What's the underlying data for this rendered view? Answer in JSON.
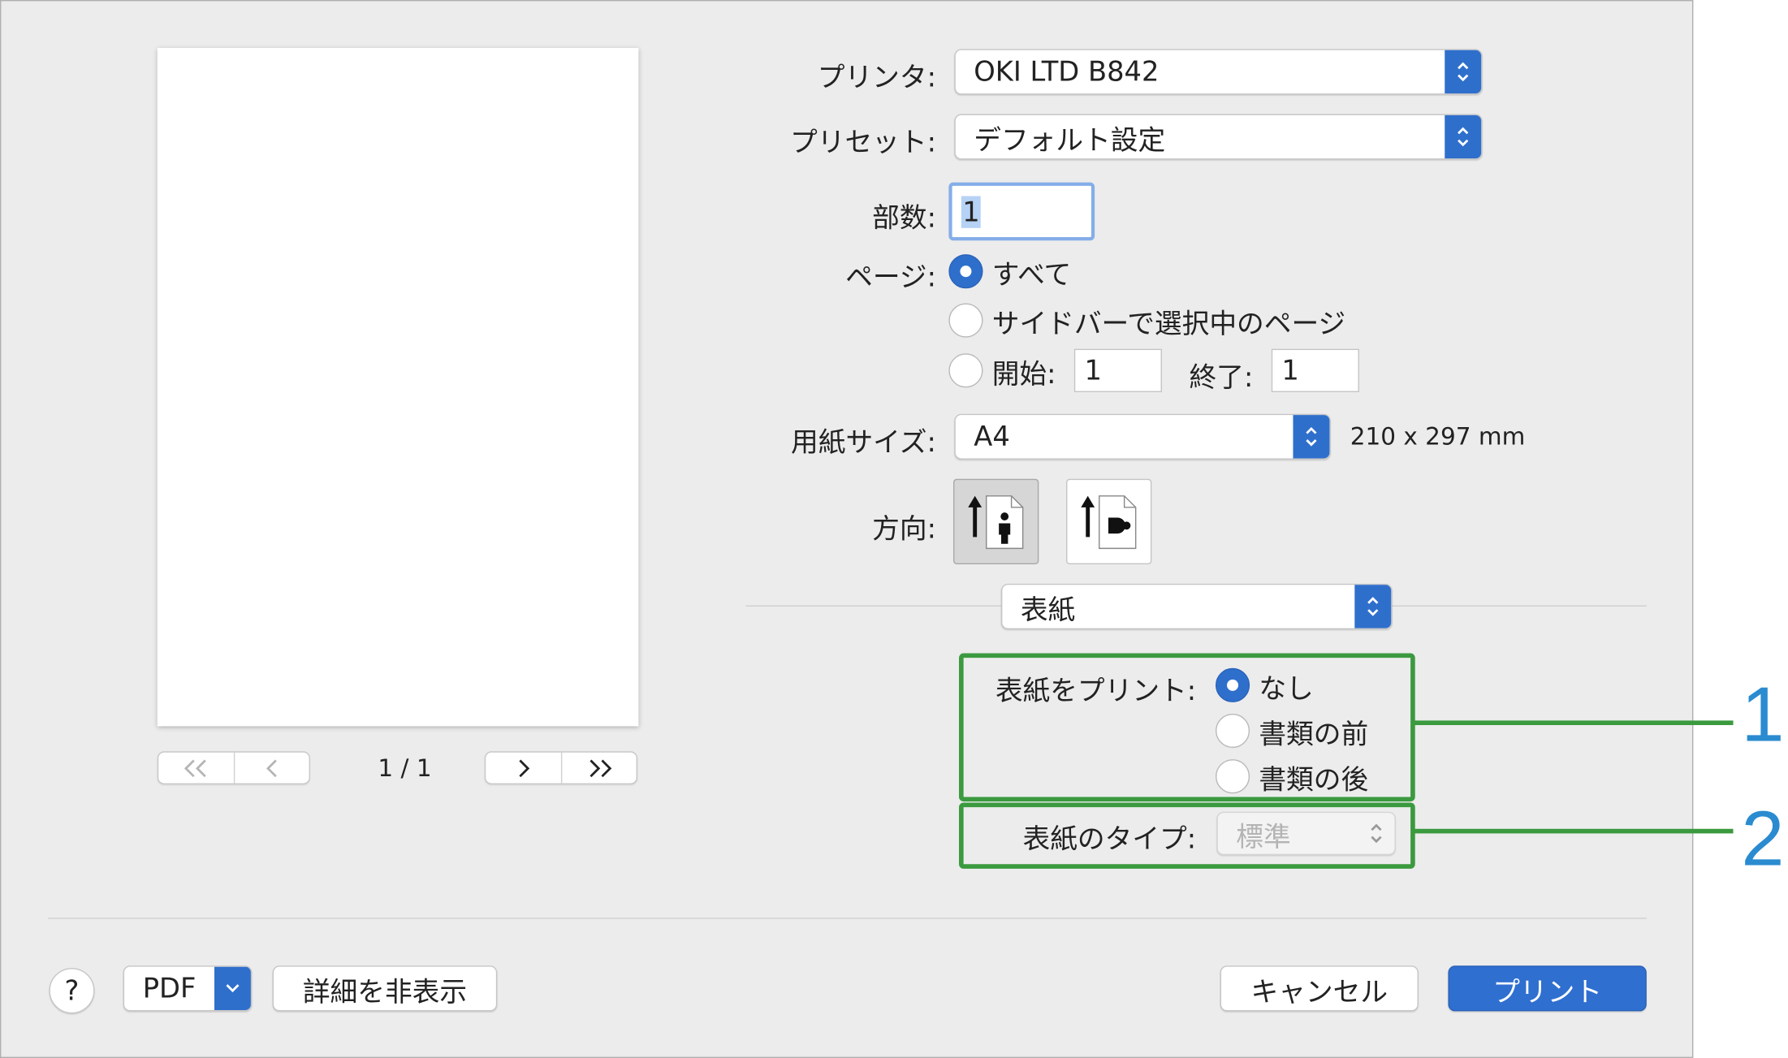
{
  "printer": {
    "label": "プリンタ:",
    "value": "OKI LTD B842"
  },
  "preset": {
    "label": "プリセット:",
    "value": "デフォルト設定"
  },
  "copies": {
    "label": "部数:",
    "value": "1"
  },
  "pages": {
    "label": "ページ:",
    "options": [
      "すべて",
      "サイドバーで選択中のページ"
    ],
    "selected": "すべて",
    "range_from_label": "開始:",
    "range_from_value": "1",
    "range_to_label": "終了:",
    "range_to_value": "1"
  },
  "paper_size": {
    "label": "用紙サイズ:",
    "value": "A4",
    "dimensions": "210 x 297 mm"
  },
  "orientation": {
    "label": "方向:",
    "selected": "portrait"
  },
  "section_popup": {
    "value": "表紙"
  },
  "cover_print": {
    "label": "表紙をプリント:",
    "options": [
      "なし",
      "書類の前",
      "書類の後"
    ],
    "selected": "なし"
  },
  "cover_type": {
    "label": "表紙のタイプ:",
    "value": "標準",
    "enabled": false
  },
  "preview": {
    "page_counter": "1 / 1"
  },
  "callouts": [
    "1",
    "2"
  ],
  "buttons": {
    "help": "?",
    "pdf": "PDF",
    "hide_details": "詳細を非表示",
    "cancel": "キャンセル",
    "print": "プリント"
  },
  "colors": {
    "accent": "#2f6fcc",
    "annotation_box": "#3b9a3f",
    "callout_text": "#2a8bd0"
  }
}
